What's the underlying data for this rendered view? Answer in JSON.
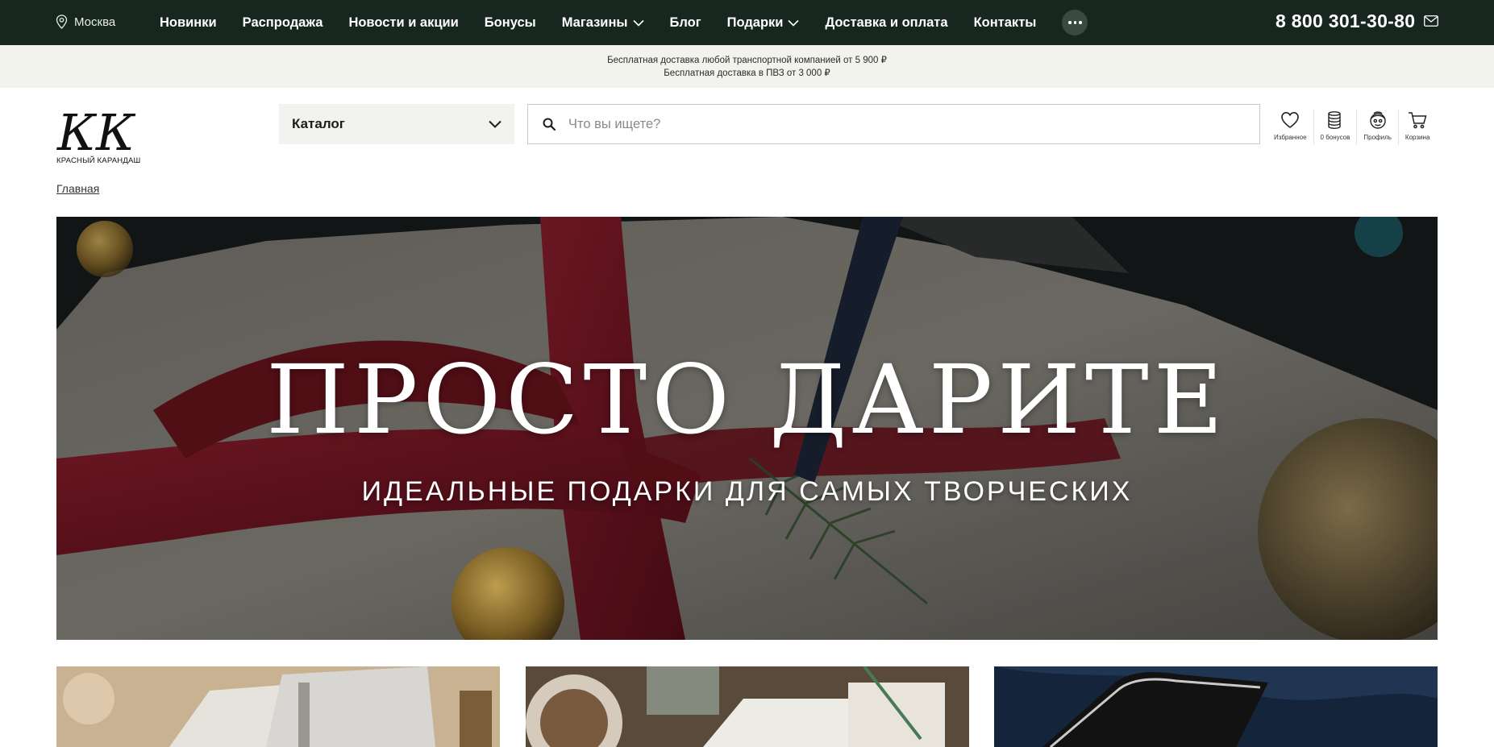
{
  "topbar": {
    "city": "Москва",
    "nav": [
      {
        "label": "Новинки",
        "dropdown": false
      },
      {
        "label": "Распродажа",
        "dropdown": false
      },
      {
        "label": "Новости и акции",
        "dropdown": false
      },
      {
        "label": "Бонусы",
        "dropdown": false
      },
      {
        "label": "Магазины",
        "dropdown": true
      },
      {
        "label": "Блог",
        "dropdown": false
      },
      {
        "label": "Подарки",
        "dropdown": true
      },
      {
        "label": "Доставка и оплата",
        "dropdown": false
      },
      {
        "label": "Контакты",
        "dropdown": false
      }
    ],
    "phone": "8 800 301-30-80"
  },
  "promo": {
    "line1": "Бесплатная доставка любой транспортной компанией от 5 900 ₽",
    "line2": "Бесплатная доставка в ПВЗ от 3 000 ₽"
  },
  "logo": {
    "monogram": "КК",
    "text": "КРАСНЫЙ КАРАНДАШ"
  },
  "catalog": {
    "label": "Каталог"
  },
  "search": {
    "placeholder": "Что вы ищете?"
  },
  "header_icons": {
    "favorites": "Избранное",
    "bonuses": "0 бонусов",
    "profile": "Профиль",
    "cart": "Корзина"
  },
  "breadcrumb": {
    "home": "Главная"
  },
  "hero": {
    "title": "ПРОСТО ДАРИТЕ",
    "subtitle": "ИДЕАЛЬНЫЕ ПОДАРКИ ДЛЯ САМЫХ ТВОРЧЕСКИХ"
  },
  "colors": {
    "topbar": "#17271f",
    "promo_bg": "#f3f3ed",
    "ribbon": "#6e1422"
  }
}
